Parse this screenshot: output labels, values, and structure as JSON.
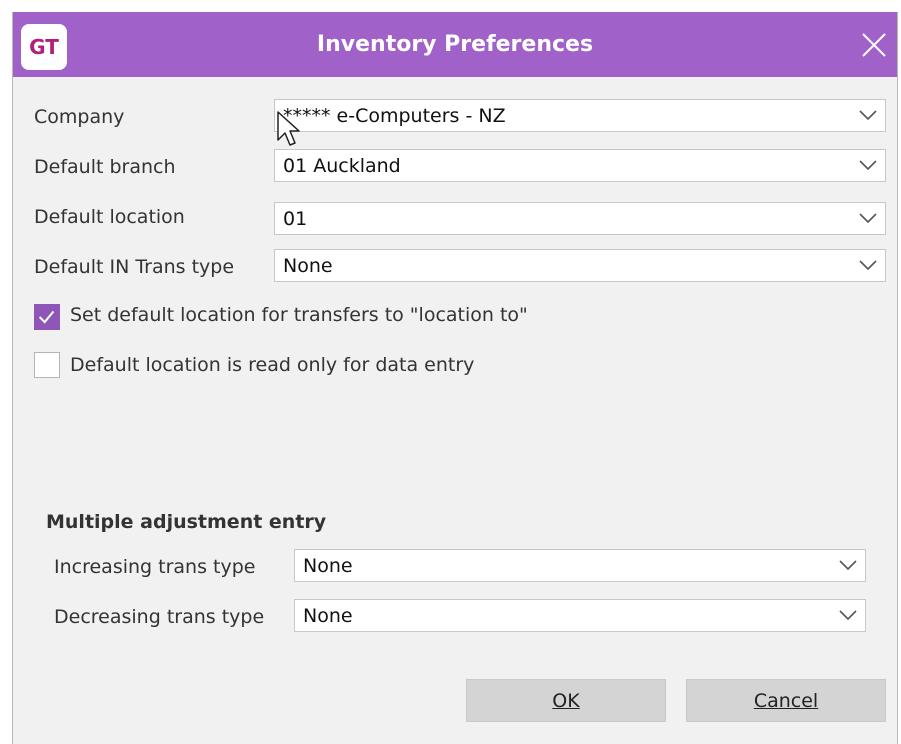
{
  "window": {
    "logo_text": "GT",
    "title": "Inventory Preferences"
  },
  "fields": {
    "company": {
      "label": "Company",
      "value": "***** e-Computers - NZ"
    },
    "default_branch": {
      "label": "Default branch",
      "value": "01 Auckland"
    },
    "default_location": {
      "label": "Default location",
      "value": "01"
    },
    "default_in_trans_type": {
      "label": "Default IN Trans type",
      "value": "None"
    }
  },
  "options": {
    "set_default_location": {
      "label": "Set default location for transfers to \"location to\"",
      "checked": true
    },
    "location_read_only": {
      "label": "Default location is read only for data entry",
      "checked": false
    }
  },
  "multiple_adjustment": {
    "title": "Multiple adjustment entry",
    "increasing": {
      "label": "Increasing trans type",
      "value": "None"
    },
    "decreasing": {
      "label": "Decreasing trans type",
      "value": "None"
    }
  },
  "buttons": {
    "ok": "OK",
    "cancel": "Cancel"
  },
  "colors": {
    "titlebar": "#a061c8",
    "checkbox_accent": "#8e56b6",
    "logo_text": "#b0207a"
  },
  "icons": [
    "close-icon",
    "chevron-down-icon",
    "checkmark-icon",
    "mouse-cursor-icon"
  ]
}
